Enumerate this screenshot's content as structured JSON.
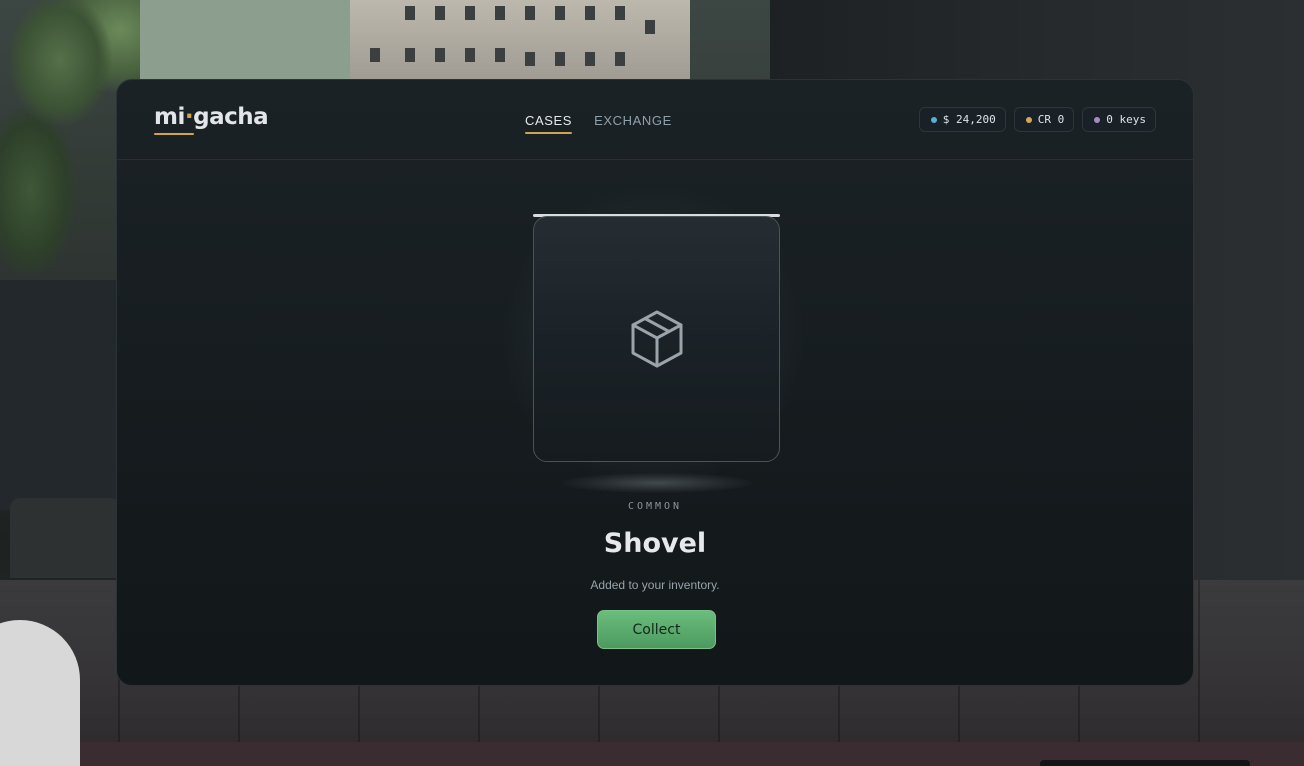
{
  "app": {
    "logo_left": "mi",
    "logo_dot": "·",
    "logo_right": "gacha"
  },
  "nav": {
    "tabs": [
      {
        "label": "CASES",
        "active": true
      },
      {
        "label": "EXCHANGE",
        "active": false
      }
    ]
  },
  "wallet": {
    "cash": {
      "text": "$ 24,200",
      "color": "#5aaed0"
    },
    "credits": {
      "text": "CR 0",
      "color": "#d4a85a"
    },
    "keys": {
      "text": "0 keys",
      "color": "#a889c6"
    }
  },
  "reveal": {
    "icon": "box-icon",
    "rarity": "COMMON",
    "item_name": "Shovel",
    "message": "Added to your inventory.",
    "collect_label": "Collect"
  },
  "colors": {
    "accent": "#d0a34d",
    "button": "#5aa96d"
  }
}
